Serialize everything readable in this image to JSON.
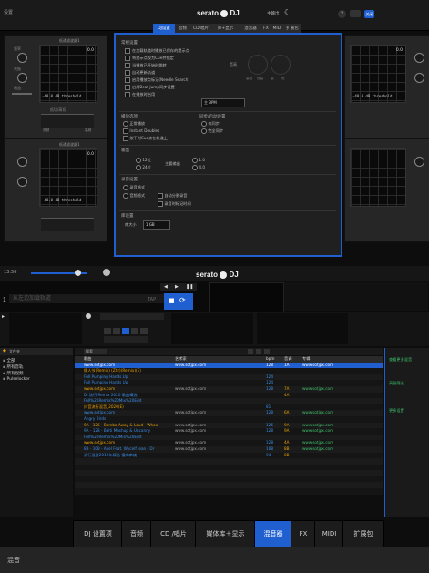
{
  "topbar": {
    "left_text": "设置",
    "brand": "serato",
    "brand_dj": "DJ",
    "right_label": "主输出",
    "close": "关闭"
  },
  "settings_tabs": [
    "DJ设置",
    "音频",
    "CD/唱片",
    "库+显示",
    "混音器",
    "FX",
    "MIDI",
    "扩展包"
  ],
  "fx_unit": {
    "graph_label": "低通滤波器1",
    "readout": "0.0",
    "threshold": "-48.0 dB threshold",
    "knob_labels": [
      "频率",
      "共振",
      "增益"
    ],
    "bottom_label": "低切/高切",
    "footer_labels": [
      "低频",
      "高频"
    ]
  },
  "dialog": {
    "section_general": "常规设置",
    "options": [
      "在加载轨道时播放已保存的提示点",
      "将提示点视为Cue并锁定",
      "当播放已开始时跳转",
      "自动更新轨道",
      "启用播放点标记(Needle Search)",
      "启用Beat Jump同步设置",
      "在播放时启用"
    ],
    "option_select": "主 BPM",
    "pitch_label": "音高",
    "knob_group_labels": [
      "高低",
      "低高",
      "高",
      "低"
    ],
    "section_playback": "播放选项",
    "playback_options": [
      "正常播放",
      "Instant Doubles",
      "按下时Cue点在轨道上"
    ],
    "playback_right_title": "同步/启动设置",
    "playback_right": [
      "仅同步",
      "完全同步"
    ],
    "section_output": "输出",
    "output_left": [
      "12位",
      "24位"
    ],
    "output_mid": "主要输出",
    "output_right": [
      "1.0",
      "4.0"
    ],
    "section_recording": "录音设置",
    "recording_options": [
      "录音格式",
      "音频格式",
      "自动分割录音",
      "录音时标记时间"
    ],
    "section_library": "库设置",
    "library_label": "库大小",
    "library_value": "1 GB"
  },
  "transport": {
    "time": "13:56",
    "deck_label": "1",
    "deck_title": "从左边加载轨道",
    "tap": "TAP",
    "brand": "serato",
    "brand_dj": "DJ"
  },
  "library": {
    "sidebar_header": "文件夹",
    "sidebar_items": [
      "全部",
      "所有音轨",
      "所有视频",
      "Pulselocker"
    ],
    "toolbar_search": "搜索",
    "columns": [
      "歌曲",
      "艺术家",
      "bpm",
      "音调",
      "专辑"
    ],
    "rows": [
      {
        "song": "www.sotjpx.com",
        "artist": "www.sotjpx.com",
        "bpm": "128",
        "key": "1A",
        "album": "www.sotjpx.com",
        "sel": true
      },
      {
        "song": "情人节(Remix) (Zhr)(Remix)(E)",
        "artist": "",
        "bpm": "",
        "key": "",
        "album": ""
      },
      {
        "song": "Full Pumping Hands Up",
        "artist": "",
        "bpm": "124",
        "key": "",
        "album": ""
      },
      {
        "song": "Full Pumping Hands Up",
        "artist": "",
        "bpm": "124",
        "key": "",
        "album": ""
      },
      {
        "song": "www.sotjpx.com",
        "artist": "www.sotjpx.com",
        "bpm": "128",
        "key": "7A",
        "album": "www.sotjpx.com"
      },
      {
        "song": "DJ 流行 Remix 2020 歌曲精选",
        "artist": "",
        "bpm": "",
        "key": "4A",
        "album": ""
      },
      {
        "song": "Full%20Remix%20Mix%20Edit",
        "artist": "",
        "bpm": "",
        "key": "",
        "album": ""
      },
      {
        "song": "抖音流行混音_2020(E)",
        "artist": "",
        "bpm": "81",
        "key": "",
        "album": ""
      },
      {
        "song": "www.sotjpx.com",
        "artist": "www.sotjpx.com",
        "bpm": "128",
        "key": "6A",
        "album": "www.sotjpx.com"
      },
      {
        "song": "Angry Birds",
        "artist": "",
        "bpm": "",
        "key": "",
        "album": ""
      },
      {
        "song": "9A - 126 - Bomba Away & Loud - Whoo",
        "artist": "www.sotjpx.com",
        "bpm": "126",
        "key": "9A",
        "album": "www.sotjpx.com"
      },
      {
        "song": "9A - 128 - Balti Mashup & Uncanny",
        "artist": "www.sotjpx.com",
        "bpm": "128",
        "key": "9A",
        "album": "www.sotjpx.com"
      },
      {
        "song": "Full%20Remix%20Mix%20Edit",
        "artist": "",
        "bpm": "",
        "key": "",
        "album": ""
      },
      {
        "song": "www.sotjpx.com",
        "artist": "www.sotjpx.com",
        "bpm": "128",
        "key": "4A",
        "album": "www.sotjpx.com"
      },
      {
        "song": "8B - 108 - Axel Feat. Wycelf Jean - Dr",
        "artist": "www.sotjpx.com",
        "bpm": "108",
        "key": "8B",
        "album": "www.sotjpx.com"
      },
      {
        "song": "流行混音2012年精选 慢嗨串烧",
        "artist": "",
        "bpm": "94",
        "key": "8B",
        "album": ""
      }
    ],
    "side_panel": [
      "查看更多混音",
      "高级筛选",
      "更多设置"
    ]
  },
  "bottom_tabs": [
    "DJ 设置项",
    "音频",
    "CD /唱片",
    "媒体库＋显示",
    "混音器",
    "FX",
    "MIDI",
    "扩展包"
  ],
  "footer": {
    "label": "混音"
  }
}
